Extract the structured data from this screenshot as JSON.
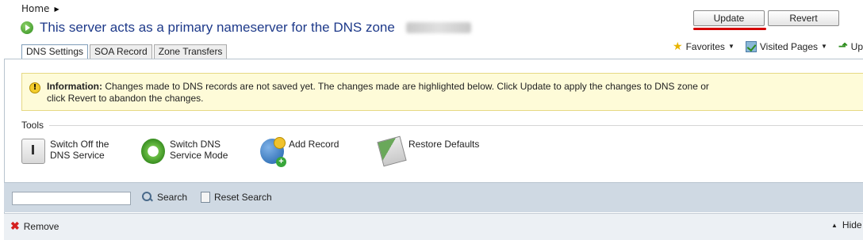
{
  "breadcrumb": {
    "home": "Home"
  },
  "title": {
    "text": "This server acts as a primary nameserver for the DNS zone"
  },
  "tabs": [
    {
      "label": "DNS Settings",
      "active": true
    },
    {
      "label": "SOA Record",
      "active": false
    },
    {
      "label": "Zone Transfers",
      "active": false
    }
  ],
  "top_tools": {
    "favorites": "Favorites",
    "visited_pages": "Visited Pages",
    "up": "Up"
  },
  "info": {
    "label": "Information:",
    "message": "Changes made to DNS records are not saved yet. The changes made are highlighted below. Click Update to apply the changes to DNS zone or click Revert to abandon the changes.",
    "update_label": "Update",
    "revert_label": "Revert"
  },
  "tools": {
    "title": "Tools",
    "items": [
      {
        "label_line1": "Switch Off the",
        "label_line2": "DNS Service",
        "icon": "power-switch-icon"
      },
      {
        "label_line1": "Switch DNS",
        "label_line2": "Service Mode",
        "icon": "switch-mode-icon"
      },
      {
        "label_line1": "Add Record",
        "label_line2": "",
        "icon": "add-record-icon"
      },
      {
        "label_line1": "Restore Defaults",
        "label_line2": "",
        "icon": "restore-defaults-icon"
      }
    ]
  },
  "search": {
    "value": "",
    "search_label": "Search",
    "reset_label": "Reset Search"
  },
  "actions": {
    "remove_label": "Remove",
    "hide_label": "Hide"
  },
  "colors": {
    "title": "#1e3a8a",
    "info_bg": "#fefbd8",
    "highlight": "#d40000",
    "searchbar_bg": "#cfd9e3"
  }
}
